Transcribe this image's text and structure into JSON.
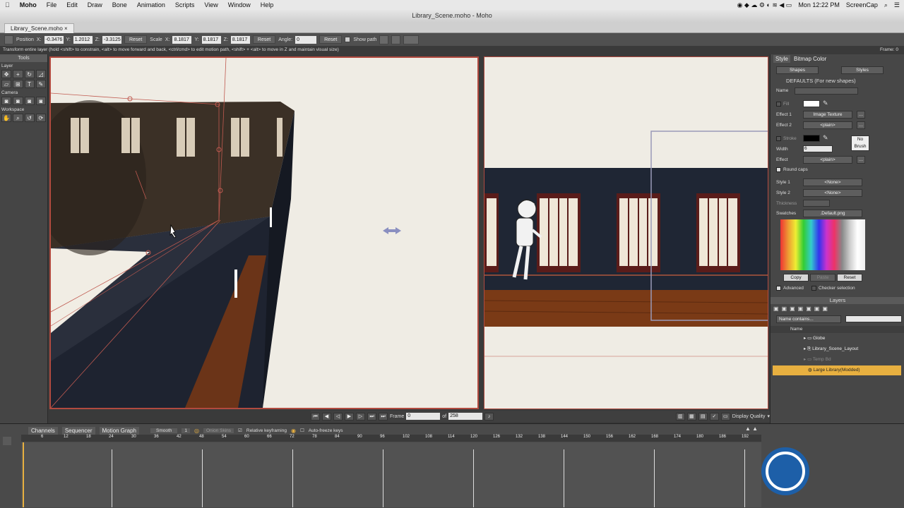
{
  "menubar": {
    "apple": "",
    "app": "Moho",
    "items": [
      "File",
      "Edit",
      "Draw",
      "Bone",
      "Animation",
      "Scripts",
      "View",
      "Window",
      "Help"
    ],
    "clock": "Mon 12:22 PM",
    "user": "ScreenCap"
  },
  "window": {
    "title": "Library_Scene.moho - Moho",
    "tab": "Library_Scene.moho"
  },
  "options": {
    "position_label": "Position",
    "x_label": "X:",
    "x": "-0.3476",
    "y_label": "Y:",
    "y": "1.2012",
    "z_label": "Z:",
    "z": "-3.3125",
    "reset1": "Reset",
    "scale_label": "Scale",
    "sx_label": "X:",
    "sx": "8.1817",
    "sy_label": "Y:",
    "sy": "8.1817",
    "sz_label": "Z:",
    "sz": "8.1817",
    "reset2": "Reset",
    "angle_label": "Angle:",
    "angle": "0",
    "reset3": "Reset",
    "show_path": "Show path"
  },
  "hint": {
    "text": "Transform entire layer (hold <shift> to constrain, <alt> to move forward and back, <ctrl/cmd> to edit motion path, <shift> + <alt> to move in Z and maintain visual size)",
    "frame": "Frame: 0"
  },
  "tools": {
    "title": "Tools",
    "layer": "Layer",
    "camera": "Camera",
    "workspace": "Workspace"
  },
  "style": {
    "tab1": "Style",
    "tab2": "Bitmap Color",
    "shapes": "Shapes",
    "styles": "Styles",
    "defaults": "DEFAULTS (For new shapes)",
    "name": "Name",
    "fill": "Fill",
    "effect1": "Effect 1",
    "effect1_val": "Image Texture",
    "effect2": "Effect 2",
    "effect2_val": "<plain>",
    "stroke": "Stroke",
    "no_brush": "No Brush",
    "width": "Width",
    "width_val": "6",
    "effect": "Effect",
    "effect_val": "<plain>",
    "round_caps": "Round caps",
    "style1": "Style 1",
    "style1_val": "<None>",
    "style2": "Style 2",
    "style2_val": "<None>",
    "thickness": "Thickness",
    "swatches": "Swatches",
    "swatches_val": ".Default.png",
    "copy": "Copy",
    "paste": "Paste",
    "reset": "Reset",
    "advanced": "Advanced",
    "checker": "Checker selection"
  },
  "layers": {
    "title": "Layers",
    "search_placeholder": "Name contains...",
    "col_name": "Name",
    "items": [
      {
        "name": "Globe"
      },
      {
        "name": "Library_Scene_Layout"
      },
      {
        "name": "Temp Bd"
      },
      {
        "name": "Large Library(Modded)"
      }
    ]
  },
  "transport": {
    "frame_label": "Frame",
    "frame": "0",
    "of": "of",
    "total": "258",
    "display_quality": "Display Quality"
  },
  "timeline": {
    "tabs": [
      "Channels",
      "Sequencer",
      "Motion Graph"
    ],
    "interp": "Smooth",
    "num": "1",
    "onion": "Onion Skins",
    "relative": "Relative keyframing",
    "autofreeze": "Auto-freeze keys",
    "ticks": [
      "6",
      "12",
      "18",
      "24",
      "30",
      "36",
      "42",
      "48",
      "54",
      "60",
      "66",
      "72",
      "78",
      "84",
      "90",
      "96",
      "102",
      "108",
      "114",
      "120",
      "126",
      "132",
      "138",
      "144",
      "150",
      "156",
      "162",
      "168",
      "174",
      "180",
      "186",
      "192"
    ]
  },
  "colors": {
    "accent": "#b14a3f",
    "selected_layer": "#e8b040"
  }
}
